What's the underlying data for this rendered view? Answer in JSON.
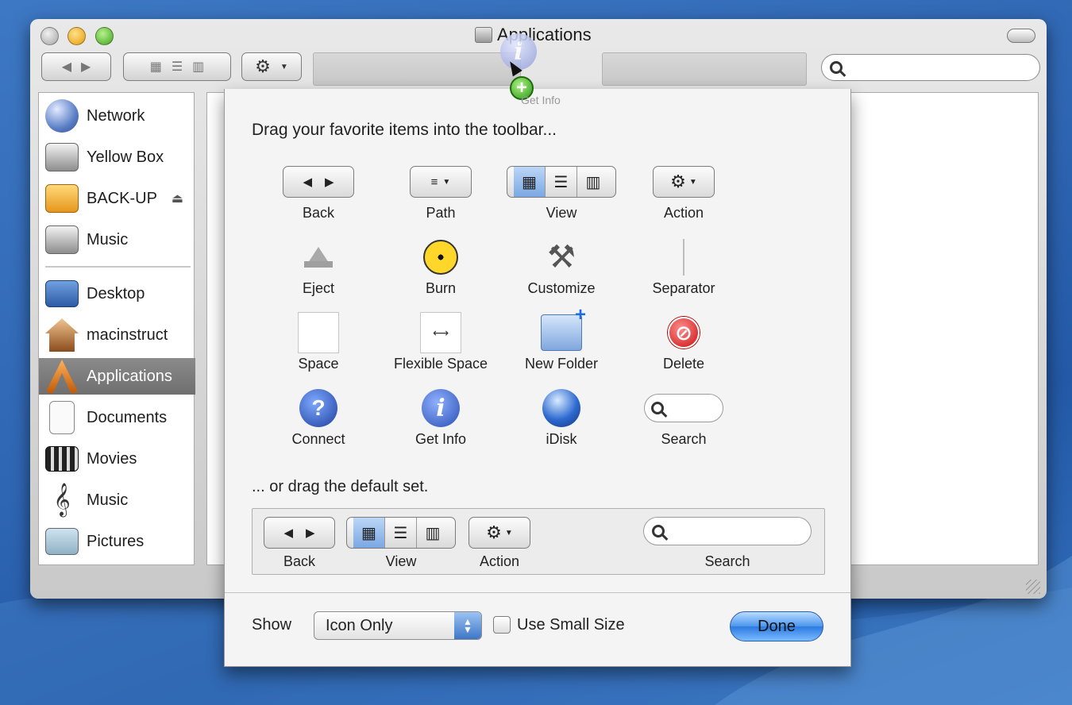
{
  "window": {
    "title": "Applications",
    "search_placeholder": "",
    "drag_label": "Get Info"
  },
  "sidebar": {
    "items": [
      {
        "label": "Network",
        "icon": "network-globe-icon"
      },
      {
        "label": "Yellow Box",
        "icon": "drive-icon"
      },
      {
        "label": "BACK-UP",
        "icon": "external-drive-icon"
      },
      {
        "label": "Music",
        "icon": "drive-icon"
      },
      {
        "label": "Desktop",
        "icon": "desktop-icon"
      },
      {
        "label": "macinstruct",
        "icon": "home-icon"
      },
      {
        "label": "Applications",
        "icon": "applications-icon",
        "selected": true
      },
      {
        "label": "Documents",
        "icon": "documents-icon"
      },
      {
        "label": "Movies",
        "icon": "movies-icon"
      },
      {
        "label": "Music",
        "icon": "music-icon"
      },
      {
        "label": "Pictures",
        "icon": "pictures-icon"
      }
    ]
  },
  "sheet": {
    "heading": "Drag your favorite items into the toolbar...",
    "palette": [
      {
        "label": "Back",
        "icon": "back-forward-icon"
      },
      {
        "label": "Path",
        "icon": "path-icon"
      },
      {
        "label": "View",
        "icon": "view-icon"
      },
      {
        "label": "Action",
        "icon": "gear-icon"
      },
      {
        "label": "Eject",
        "icon": "eject-icon"
      },
      {
        "label": "Burn",
        "icon": "burn-icon"
      },
      {
        "label": "Customize",
        "icon": "tools-icon"
      },
      {
        "label": "Separator",
        "icon": "separator-icon"
      },
      {
        "label": "Space",
        "icon": "space-icon"
      },
      {
        "label": "Flexible Space",
        "icon": "flexible-space-icon"
      },
      {
        "label": "New Folder",
        "icon": "new-folder-icon"
      },
      {
        "label": "Delete",
        "icon": "delete-icon"
      },
      {
        "label": "Connect",
        "icon": "connect-icon"
      },
      {
        "label": "Get Info",
        "icon": "info-icon"
      },
      {
        "label": "iDisk",
        "icon": "idisk-icon"
      },
      {
        "label": "Search",
        "icon": "search-icon"
      }
    ],
    "default_text": "... or drag the default set.",
    "default_set": [
      {
        "label": "Back"
      },
      {
        "label": "View"
      },
      {
        "label": "Action"
      },
      {
        "label": "Search"
      }
    ],
    "show_label": "Show",
    "show_value": "Icon Only",
    "small_size_label": "Use Small Size",
    "small_size_checked": false,
    "done_label": "Done"
  },
  "colors": {
    "accent": "#4b96ee",
    "desktop": "#2f66b3"
  }
}
